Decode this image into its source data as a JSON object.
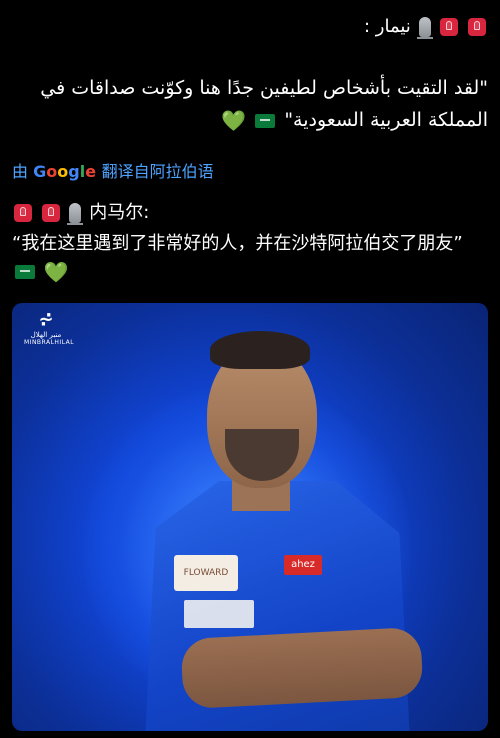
{
  "post": {
    "title_ar": "نيمار :",
    "quote_ar_line1": "\"لقد التقيت بأشخاص لطيفين جدًا هنا وكوّنت صداقات في",
    "quote_ar_line2": "المملكة العربية السعودية\"",
    "translate_prefix": "由",
    "translate_google": "Google",
    "translate_suffix": "翻译自阿拉伯语",
    "title_zh": "内马尔:",
    "quote_zh": "“我在这里遇到了非常好的人，并在沙特阿拉伯交了朋友”"
  },
  "image": {
    "logo_mark": "⩫",
    "logo_text_ar": "منبر الهلال",
    "logo_text_en": "MINBRALHILAL",
    "patch_text": "ahez",
    "sponsor_text": "FLOWARD"
  },
  "colors": {
    "background": "#000000",
    "card_blue": "#1146d9",
    "google_blue": "#4285f4",
    "heart_green": "#3bd16f"
  },
  "icons": [
    "siren-icon",
    "microphone-icon",
    "saudi-flag-icon",
    "green-heart-icon"
  ]
}
